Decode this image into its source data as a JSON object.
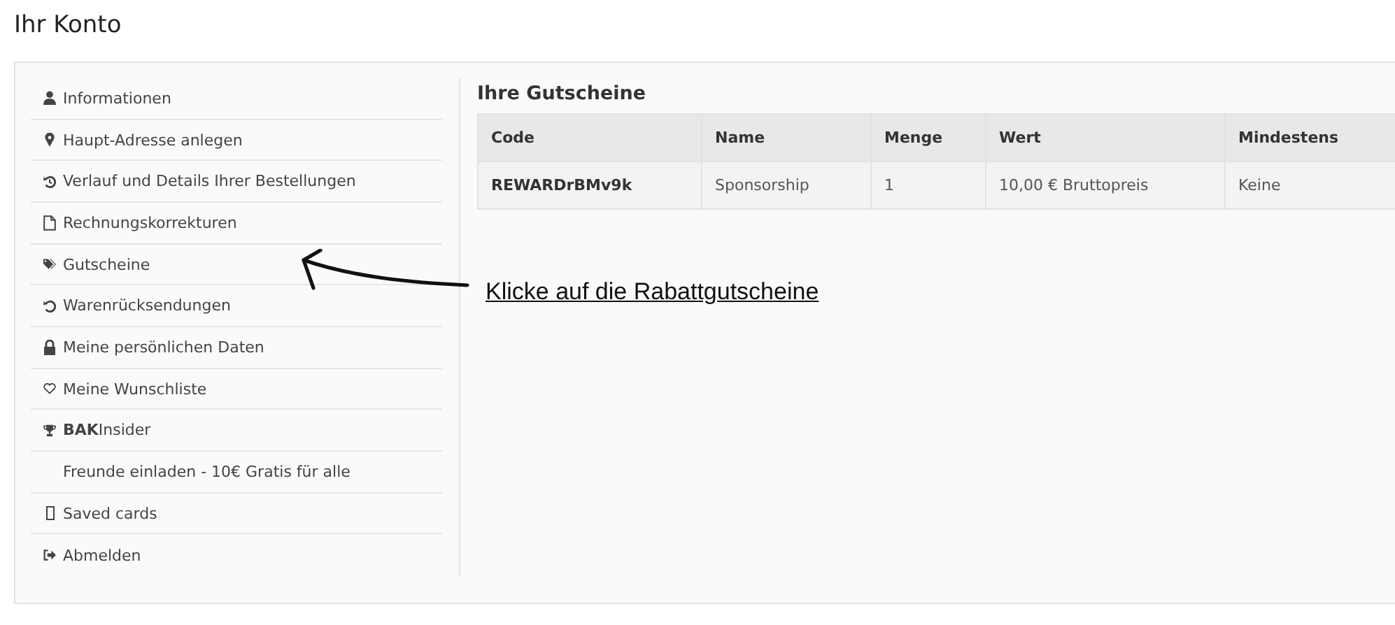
{
  "page_title": "Ihr Konto",
  "sidebar": {
    "items": [
      {
        "label": "Informationen"
      },
      {
        "label": "Haupt-Adresse anlegen"
      },
      {
        "label": "Verlauf und Details Ihrer Bestellungen"
      },
      {
        "label": "Rechnungskorrekturen"
      },
      {
        "label": "Gutscheine"
      },
      {
        "label": "Warenrücksendungen"
      },
      {
        "label": "Meine persönlichen Daten"
      },
      {
        "label": "Meine Wunschliste"
      },
      {
        "label": "**BAK**Insider"
      },
      {
        "label": "Freunde einladen - 10€ Gratis für alle"
      },
      {
        "label": "Saved cards"
      },
      {
        "label": "Abmelden"
      }
    ]
  },
  "vouchers": {
    "title": "Ihre Gutscheine",
    "columns": [
      "Code",
      "Name",
      "Menge",
      "Wert",
      "Mindestens"
    ],
    "rows": [
      [
        "REWARDrBMv9k",
        "Sponsorship",
        "1",
        "10,00 € Bruttopreis",
        "Keine"
      ]
    ]
  },
  "annotation": {
    "text": "Klicke auf die Rabattgutscheine"
  }
}
